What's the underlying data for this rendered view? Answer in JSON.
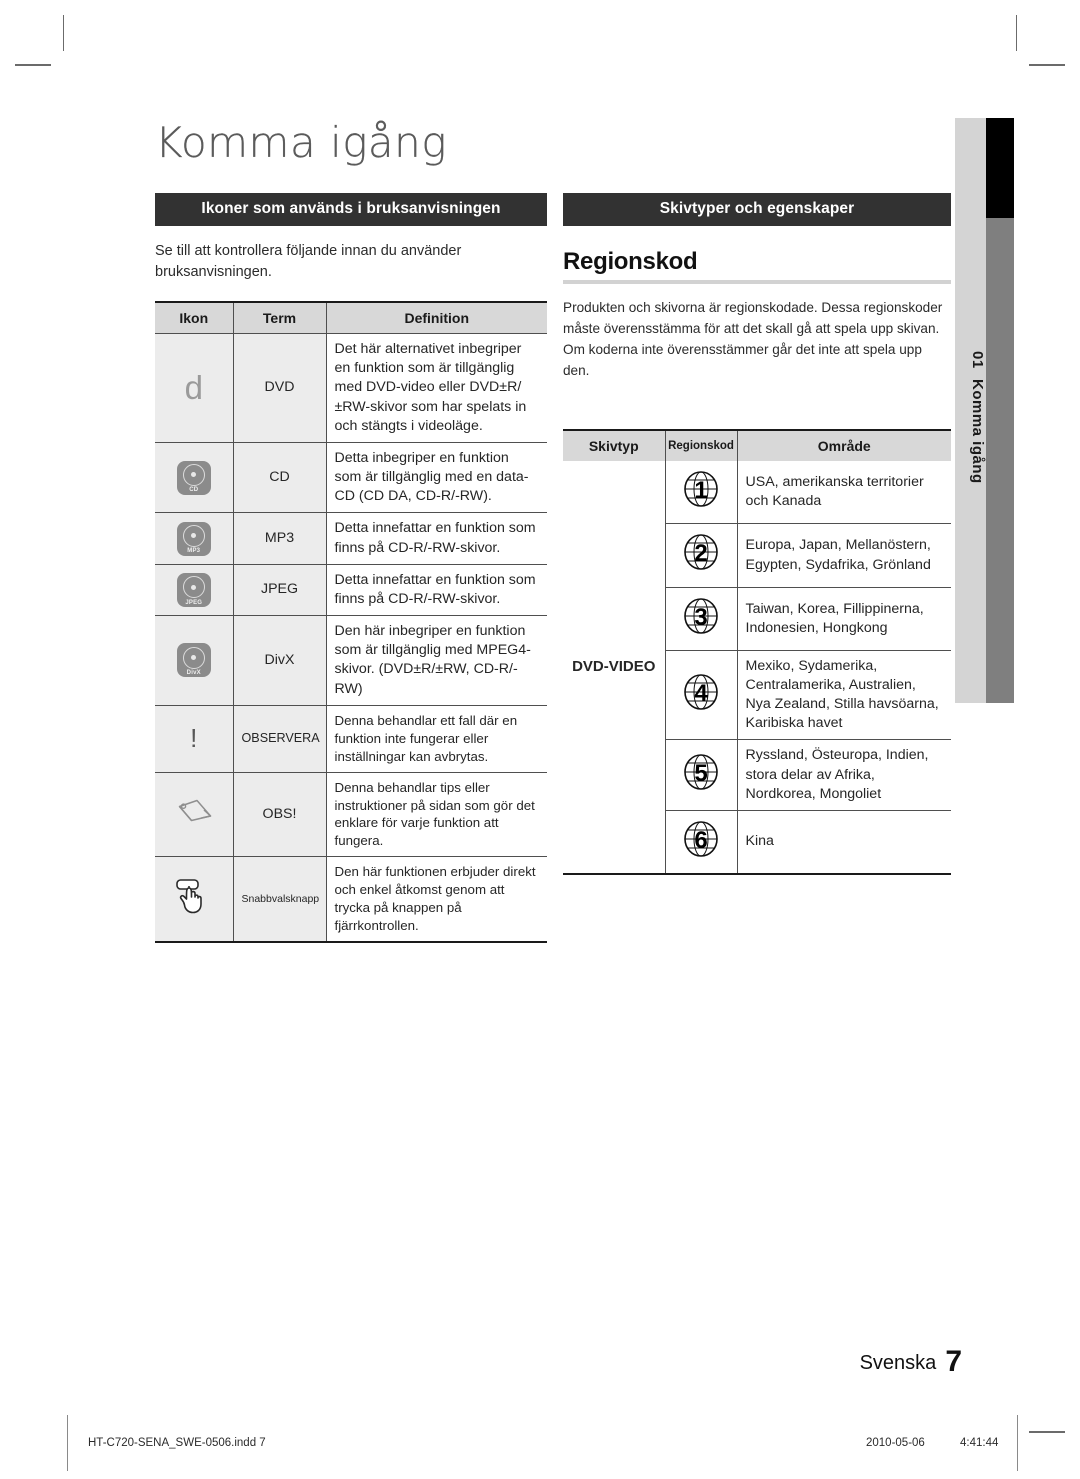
{
  "chapter": {
    "title": "Komma igång",
    "tab_number": "01",
    "tab_label": "Komma igång"
  },
  "left_column": {
    "banner": "Ikoner som används i bruksanvisningen",
    "intro": "Se till att kontrollera följande innan du använder bruksanvisningen.",
    "table": {
      "headers": [
        "Ikon",
        "Term",
        "Definition"
      ],
      "rows": [
        {
          "icon": "dvd-d-icon",
          "icon_label": "d",
          "term": "DVD",
          "definition": "Det här alternativet inbegriper en funktion som är tillgänglig med DVD-video eller DVD±R/±RW-skivor som har spelats in och stängts i videoläge."
        },
        {
          "icon": "cd-disc-icon",
          "icon_label": "CD",
          "term": "CD",
          "definition": "Detta inbegriper en funktion som är tillgänglig med en data-CD (CD DA, CD-R/-RW)."
        },
        {
          "icon": "mp3-disc-icon",
          "icon_label": "MP3",
          "term": "MP3",
          "definition": "Detta innefattar en funktion som finns på CD-R/-RW-skivor."
        },
        {
          "icon": "jpeg-disc-icon",
          "icon_label": "JPEG",
          "term": "JPEG",
          "definition": "Detta innefattar en funktion som finns på CD-R/-RW-skivor."
        },
        {
          "icon": "divx-disc-icon",
          "icon_label": "DivX",
          "term": "DivX",
          "definition": "Den här inbegriper en funktion som är tillgänglig med MPEG4-skivor. (DVD±R/±RW, CD-R/-RW)"
        },
        {
          "icon": "exclamation-icon",
          "icon_label": "!",
          "term": "OBSERVERA",
          "definition": "Denna behandlar ett fall där en funktion inte fungerar eller inställningar kan avbrytas."
        },
        {
          "icon": "pencil-icon",
          "icon_label": "",
          "term": "OBS!",
          "definition": "Denna behandlar tips eller instruktioner på sidan som gör det enklare för varje funktion att fungera."
        },
        {
          "icon": "hand-press-button-icon",
          "icon_label": "",
          "term": "Snabbvalsknapp",
          "definition": "Den här funktionen erbjuder direkt och enkel åtkomst genom att trycka på knappen på fjärrkontrollen."
        }
      ]
    }
  },
  "right_column": {
    "banner": "Skivtyper och egenskaper",
    "subheading": "Regionskod",
    "body": "Produkten och skivorna är regionskodade. Dessa regionskoder måste överensstämma för att det skall gå att spela upp skivan. Om koderna inte överensstämmer går det inte att spela upp den.",
    "table": {
      "headers": [
        "Skivtyp",
        "Regionskod",
        "Område"
      ],
      "disc_type": "DVD-VIDEO",
      "rows": [
        {
          "code": "1",
          "area": "USA, amerikanska territorier och Kanada"
        },
        {
          "code": "2",
          "area": "Europa, Japan, Mellanöstern, Egypten, Sydafrika, Grönland"
        },
        {
          "code": "3",
          "area": "Taiwan, Korea, Fillippinerna, Indonesien, Hongkong"
        },
        {
          "code": "4",
          "area": "Mexiko, Sydamerika, Centralamerika, Australien, Nya Zealand, Stilla havsöarna, Karibiska havet"
        },
        {
          "code": "5",
          "area": "Ryssland, Östeuropa, Indien, stora delar av Afrika, Nordkorea, Mongoliet"
        },
        {
          "code": "6",
          "area": "Kina"
        }
      ]
    }
  },
  "footer": {
    "language": "Svenska",
    "page_number": "7",
    "print_file": "HT-C720-SENA_SWE-0506.indd   7",
    "print_date": "2010-05-06",
    "print_time": "4:41:44"
  },
  "colors": {
    "banner_bg": "#323232",
    "header_bg": "#d8d8d8",
    "shade_bg": "#ececec",
    "tab_bg": "#d4d4d4",
    "tab_ink": "#7f7f7f"
  }
}
